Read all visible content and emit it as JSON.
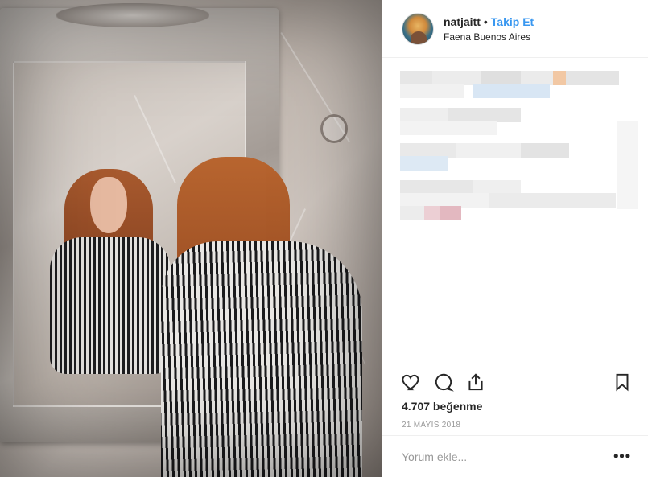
{
  "post": {
    "username": "natjaitt",
    "separator": "•",
    "follow_label": "Takip Et",
    "location": "Faena Buenos Aires",
    "likes_text": "4.707 beğenme",
    "date_text": "21 MAYIS 2018",
    "comment_placeholder": "Yorum ekle...",
    "more_label": "•••",
    "accent_color": "#3897f0"
  },
  "icons": {
    "like": "heart-icon",
    "comment": "speech-bubble-icon",
    "share": "share-upload-icon",
    "save": "bookmark-icon"
  }
}
